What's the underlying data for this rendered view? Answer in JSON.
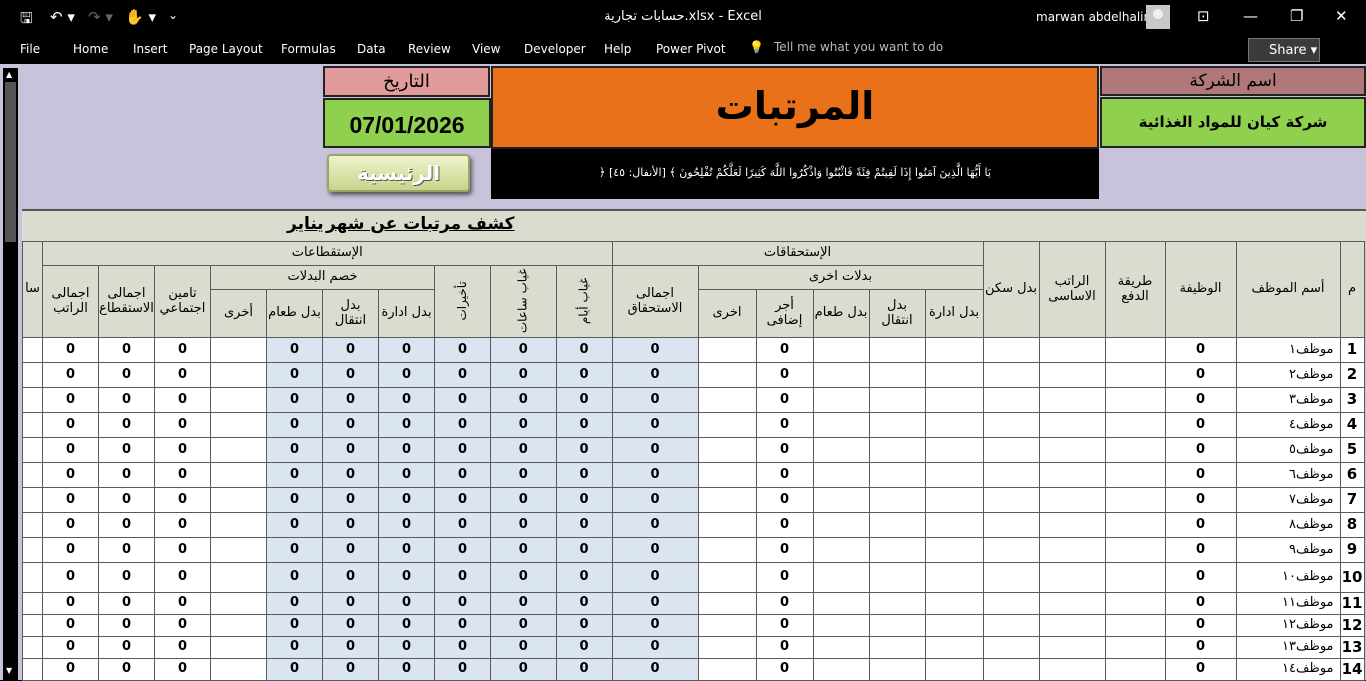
{
  "titlebar": {
    "title": "حسابات تجارية.xlsx  -  Excel",
    "user": "marwan abdelhalim",
    "qa_save": "🖫",
    "qa_undo": "↶ ▾",
    "qa_redo": "↷ ▾",
    "qa_touch": "✋ ▾",
    "qa_more": "⌄",
    "btn_ribbon": "⊡",
    "btn_min": "—",
    "btn_max": "❐",
    "btn_close": "✕"
  },
  "menu": {
    "items": [
      "File",
      "Home",
      "Insert",
      "Page Layout",
      "Formulas",
      "Data",
      "Review",
      "View",
      "Developer",
      "Help",
      "Power Pivot"
    ],
    "tell_me": "Tell me what you want to do",
    "share": "Share"
  },
  "sheet": {
    "date_label": "التاريخ",
    "date_value": "07/01/2026",
    "title": "المرتبات",
    "quote": "يَا أَيُّهَا الَّذِينَ آمَنُوا إِذَا لَقِيتُمْ فِئَةً فَاثْبُتُوا وَاذْكُرُوا اللَّهَ كَثِيرًا لَعَلَّكُمْ تُفْلِحُونَ ﴾ [الأنفال: ٤٥] ﴿",
    "company_label": "اسم الشركة",
    "company_value": "شركة كيان للمواد الغذائية",
    "home_button": "الرئيسية",
    "report_title": "كشف مرتبات عن شهر",
    "report_month": "يناير"
  },
  "table": {
    "h_m": "م",
    "h_name": "أسم الموظف",
    "h_job": "الوظيفة",
    "h_pay": "طريقة الدفع",
    "h_basic": "الراتب الاساسى",
    "h_housing": "بدل سكن",
    "h_entitlements": "الإستحقاقات",
    "h_other_allow": "بدلات اخرى",
    "h_mgmt": "بدل ادارة",
    "h_trans": "بدل انتقال",
    "h_food": "بدل طعام",
    "h_overtime": "أجر إضافى",
    "h_other": "اخرى",
    "h_total_ent": "اجمالى الاستحقاق",
    "h_deductions": "الإستقطاعات",
    "h_days": "غياب أيام",
    "h_hours": "غياب ساعات",
    "h_late": "تأخيرات",
    "h_allow_ded": "خصم البدلات",
    "h_d_mgmt": "بدل ادارة",
    "h_d_trans": "بدل انتقال",
    "h_d_food": "بدل طعام",
    "h_d_other": "أخرى",
    "h_insurance": "تامين اجتماعي",
    "h_total_ded": "اجمالى الاستقطاع",
    "h_net": "اجمالى الراتب",
    "h_sig": "سا",
    "zero": "0",
    "names": [
      "موظف١",
      "موظف٢",
      "موظف٣",
      "موظف٤",
      "موظف٥",
      "موظف٦",
      "موظف٧",
      "موظف٨",
      "موظف٩",
      "موظف١٠",
      "موظف١١",
      "موظف١٢",
      "موظف١٣",
      "موظف١٤"
    ],
    "row_numbers": [
      "1",
      "2",
      "3",
      "4",
      "5",
      "6",
      "7",
      "8",
      "9",
      "10",
      "11",
      "12",
      "13",
      "14"
    ]
  }
}
